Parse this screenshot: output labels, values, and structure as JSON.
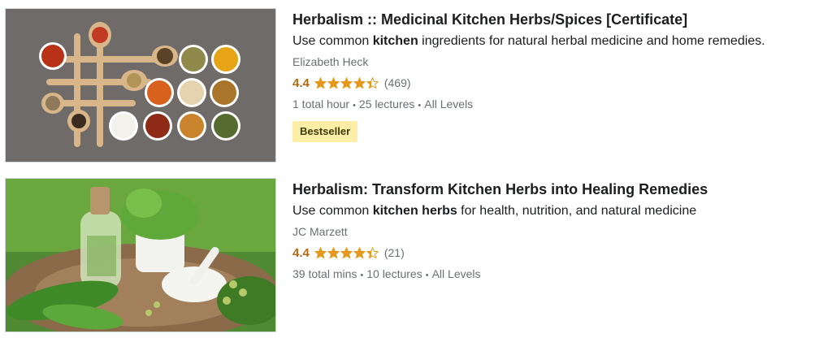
{
  "courses": [
    {
      "title": "Herbalism :: Medicinal Kitchen Herbs/Spices [Certificate]",
      "description": {
        "pre": "Use common ",
        "bold": "kitchen",
        "post": " ingredients for natural herbal medicine and home remedies."
      },
      "author": "Elizabeth Heck",
      "rating": "4.4",
      "rating_value": 4.4,
      "rating_count": "(469)",
      "meta": [
        "1 total hour",
        "25 lectures",
        "All Levels"
      ],
      "badge": "Bestseller",
      "thumbnail": "spices-on-wooden-spoons-image"
    },
    {
      "title": "Herbalism: Transform Kitchen Herbs into Healing Remedies",
      "description": {
        "pre": "Use common ",
        "bold": "kitchen herbs",
        "post": " for health, nutrition, and natural medicine"
      },
      "author": "JC Marzett",
      "rating": "4.4",
      "rating_value": 4.4,
      "rating_count": "(21)",
      "meta": [
        "39 total mins",
        "10 lectures",
        "All Levels"
      ],
      "thumbnail": "herbs-mortar-and-bottle-image"
    }
  ],
  "colors": {
    "rating": "#b4690e",
    "star": "#e59819",
    "badge_bg": "#fceea7",
    "badge_text": "#3d3c0a",
    "muted": "#6a6f73"
  }
}
